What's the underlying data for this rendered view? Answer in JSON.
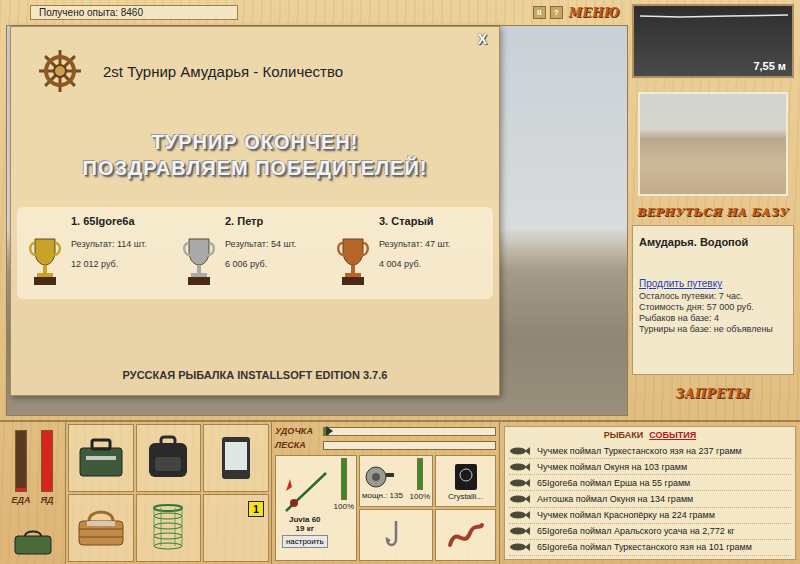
{
  "experience": "Получено опыта: 8460",
  "top_controls": {
    "pause": "II",
    "help": "?",
    "menu": "МЕНЮ"
  },
  "dialog": {
    "title": "2st Турнир Амударья - Количество",
    "close": "X",
    "headline": [
      "ТУРНИР ОКОНЧЕН!",
      "ПОЗДРАВЛЯЕМ ПОБЕДИТЕЛЕЙ!"
    ],
    "winners": [
      {
        "place": "1. 65Igore6a",
        "result": "Результат: 114 шт.",
        "prize": "12 012 руб.",
        "color": "#c9a227"
      },
      {
        "place": "2. Петр",
        "result": "Результат: 54 шт.",
        "prize": "6 006 руб.",
        "color": "#a9a9a9"
      },
      {
        "place": "3. Старый",
        "result": "Результат: 47 шт.",
        "prize": "4 004 руб.",
        "color": "#b5652a"
      }
    ],
    "footer": "РУССКАЯ РЫБАЛКА INSTALLSOFT EDITION 3.7.6"
  },
  "sonar": {
    "depth": "7,55 м"
  },
  "right_panel": {
    "return_button": "ВЕРНУТЬСЯ НА БАЗУ",
    "location": "Амударья. Водопой",
    "extend_link": "Продлить путевку",
    "info": [
      "Осталось путевки: 7 час.",
      "Стоимость дня: 57 000 руб.",
      "Рыбаков на базе: 4",
      "Турниры на базе: не объявлены"
    ],
    "bans_button": "ЗАПРЕТЫ"
  },
  "needs": [
    {
      "label": "ЕДА",
      "level": 0.05
    },
    {
      "label": "ЯД",
      "level": 1
    }
  ],
  "inventory": [
    {
      "kind": "tackle-box",
      "badge": ""
    },
    {
      "kind": "backpack",
      "badge": ""
    },
    {
      "kind": "phone",
      "badge": ""
    },
    {
      "kind": "basket",
      "badge": ""
    },
    {
      "kind": "keepnet",
      "badge": ""
    },
    {
      "kind": "empty",
      "badge": "1"
    }
  ],
  "gauges": [
    {
      "label": "УДОЧКА",
      "level": 0.03
    },
    {
      "label": "ЛЕСКА",
      "level": 0
    }
  ],
  "tackle": {
    "rod": {
      "name": "Juvia 60",
      "weight": "19 кг",
      "wear": "100%",
      "wear_level": 1,
      "button": "настроить"
    },
    "reel": {
      "power": "мощн.: 135",
      "wear": "100%",
      "wear_level": 1
    },
    "line": {
      "name": "Crystalli..."
    }
  },
  "events": {
    "tabs": [
      {
        "label": "РЫБАКИ",
        "selected": false
      },
      {
        "label": "СОБЫТИЯ",
        "selected": true
      }
    ],
    "entries": [
      "Чучмек поймал Туркестанского язя на 237 грамм",
      "Чучмек поймал Окуня на 103 грамм",
      "65Igore6a поймал Ерша на 55 грамм",
      "Антошка поймал Окуня на 134 грамм",
      "Чучмек поймал Краснопёрку на 224 грамм",
      "65Igore6a поймал Аральского усача на 2,772 кг",
      "65Igore6a поймал Туркестанского язя на 101 грамм"
    ]
  }
}
